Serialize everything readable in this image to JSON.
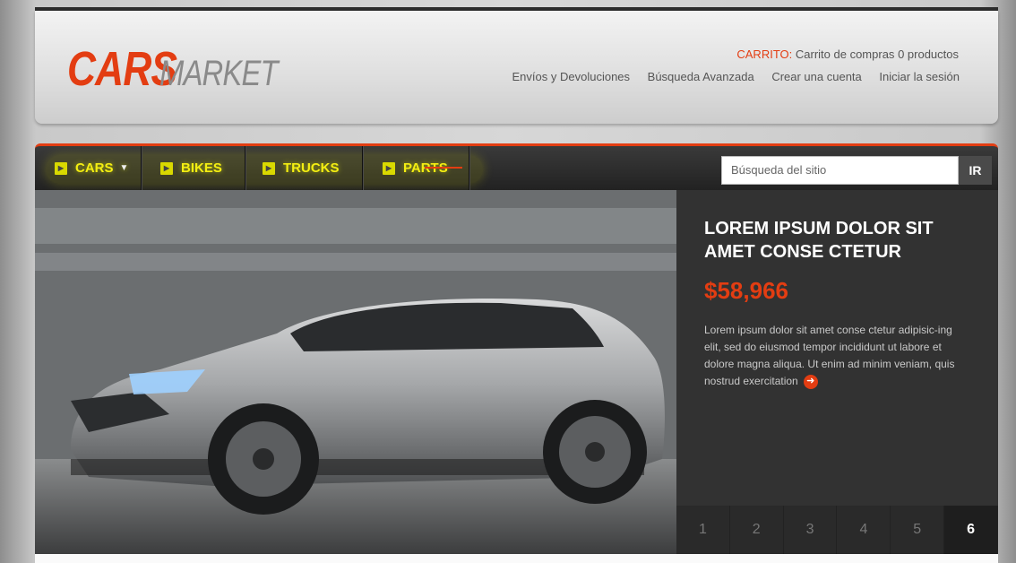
{
  "logo": {
    "part1": "CARS",
    "part2": "MARKET"
  },
  "cart": {
    "label": "CARRITO:",
    "text": "Carrito de compras",
    "count": "0 productos"
  },
  "toplinks": [
    "Envíos y Devoluciones",
    "Búsqueda Avanzada",
    "Crear una cuenta",
    "Iniciar la sesión"
  ],
  "nav": {
    "items": [
      {
        "label": "CARS"
      },
      {
        "label": "BIKES"
      },
      {
        "label": "TRUCKS"
      },
      {
        "label": "PARTS"
      }
    ],
    "search_placeholder": "Búsqueda del sitio",
    "go_label": "IR"
  },
  "hero": {
    "title": "LOREM IPSUM DOLOR SIT AMET CONSE CTETUR",
    "price": "$58,966",
    "description": "Lorem ipsum dolor sit amet conse ctetur adipisic-ing elit, sed do eiusmod tempor incididunt ut labore et dolore magna aliqua. Ut enim ad minim veniam, quis nostrud exercitation",
    "pages": [
      "1",
      "2",
      "3",
      "4",
      "5",
      "6"
    ],
    "active_page": "6"
  },
  "colors": {
    "accent": "#e33d12",
    "nav_text": "#f4ee12",
    "panel": "#323232"
  }
}
